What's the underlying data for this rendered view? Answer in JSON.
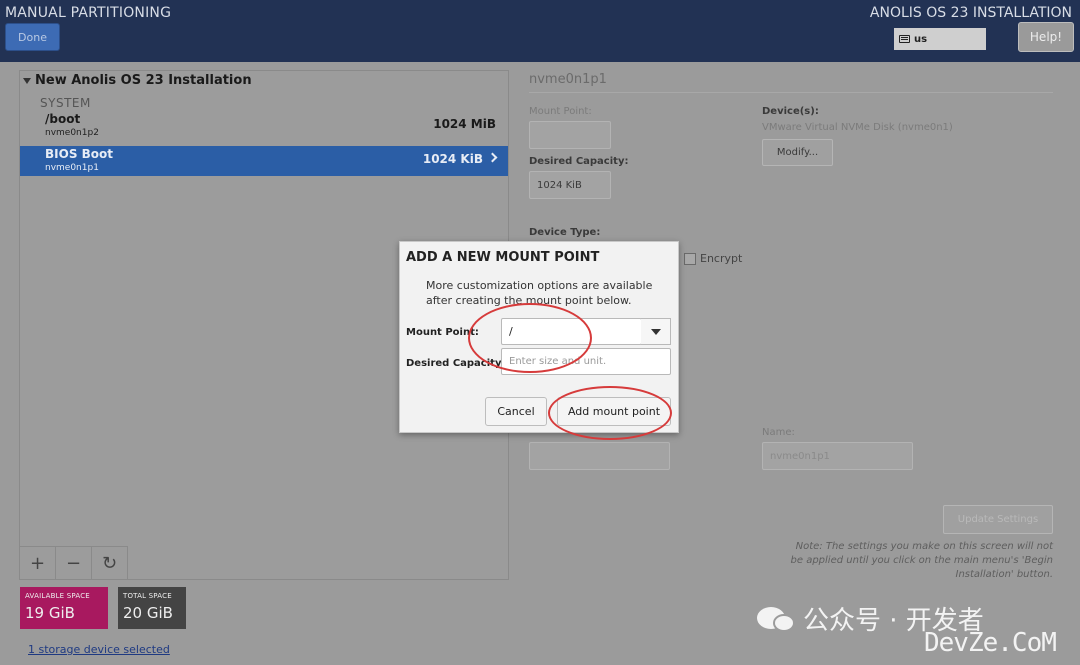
{
  "header": {
    "title": "MANUAL PARTITIONING",
    "product": "ANOLIS OS 23 INSTALLATION",
    "done_label": "Done",
    "keyboard_layout": "us",
    "help_label": "Help!"
  },
  "left_panel": {
    "installation_title": "New Anolis OS 23 Installation",
    "section_label": "SYSTEM",
    "partitions": [
      {
        "name": "/boot",
        "device": "nvme0n1p2",
        "size": "1024 MiB",
        "selected": false
      },
      {
        "name": "BIOS Boot",
        "device": "nvme0n1p1",
        "size": "1024 KiB",
        "selected": true
      }
    ],
    "toolbar": {
      "add": "+",
      "remove": "−",
      "refresh": "↻"
    },
    "available_space": {
      "label": "AVAILABLE SPACE",
      "value": "19 GiB"
    },
    "total_space": {
      "label": "TOTAL SPACE",
      "value": "20 GiB"
    },
    "storage_link": "1 storage device selected"
  },
  "details": {
    "title": "nvme0n1p1",
    "mount_point_label": "Mount Point:",
    "desired_capacity_label": "Desired Capacity:",
    "desired_capacity_value": "1024 KiB",
    "devices_label": "Device(s):",
    "device_name": "VMware Virtual NVMe Disk (nvme0n1)",
    "modify_label": "Modify...",
    "device_type_label": "Device Type:",
    "encrypt_label": "Encrypt",
    "name_label": "Name:",
    "name_value": "nvme0n1p1",
    "update_label": "Update Settings",
    "note": "Note: The settings you make on this screen will not be applied until you click on the main menu's 'Begin Installation' button."
  },
  "dialog": {
    "title": "ADD A NEW MOUNT POINT",
    "description": "More customization options are available after creating the mount point below.",
    "mount_point_label": "Mount Point:",
    "mount_point_value": "/",
    "desired_capacity_label": "Desired Capacity:",
    "desired_capacity_placeholder": "Enter size and unit.",
    "cancel_label": "Cancel",
    "add_label": "Add mount point"
  },
  "watermark": {
    "line1": "公众号 · 开发者",
    "line2": "DevZe.CoM"
  },
  "colors": {
    "header_bg": "#223254",
    "selected_row": "#2b5ea6",
    "available_space": "#a8195f",
    "total_space": "#444444",
    "annotation": "#d63b3b"
  }
}
